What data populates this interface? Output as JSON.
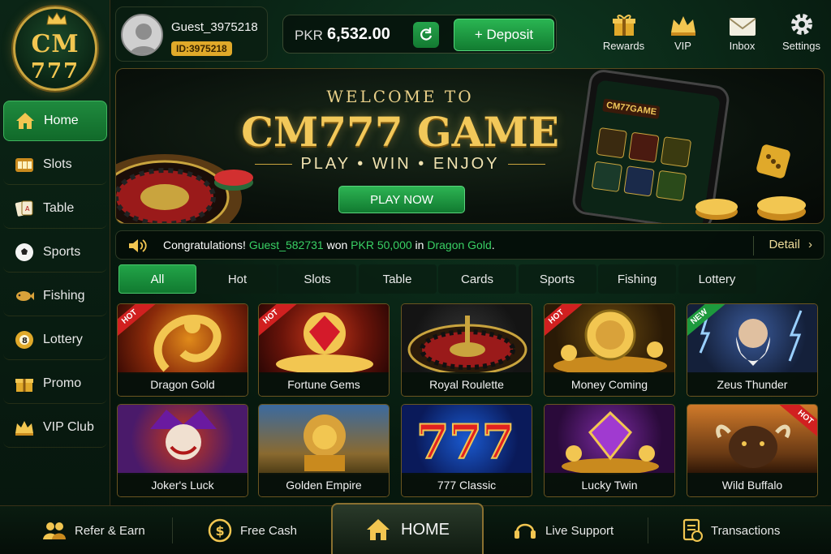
{
  "brand": {
    "logo_line1": "CM",
    "logo_line2": "777"
  },
  "sidebar": {
    "items": [
      {
        "label": "Home",
        "icon": "home-icon",
        "active": true
      },
      {
        "label": "Slots",
        "icon": "slots-icon"
      },
      {
        "label": "Table",
        "icon": "cards-icon"
      },
      {
        "label": "Sports",
        "icon": "soccer-ball-icon"
      },
      {
        "label": "Fishing",
        "icon": "fish-icon"
      },
      {
        "label": "Lottery",
        "icon": "lottery-ball-icon"
      },
      {
        "label": "Promo",
        "icon": "gift-icon"
      },
      {
        "label": "VIP Club",
        "icon": "crown-icon"
      }
    ]
  },
  "user": {
    "name": "Guest_3975218",
    "id": "ID:3975218"
  },
  "wallet": {
    "currency": "PKR",
    "balance": "6,532.00",
    "deposit_label": "+ Deposit"
  },
  "top_icons": [
    {
      "label": "Rewards",
      "icon": "gift-icon"
    },
    {
      "label": "VIP",
      "icon": "crown-icon"
    },
    {
      "label": "Inbox",
      "icon": "envelope-icon"
    },
    {
      "label": "Settings",
      "icon": "gear-icon"
    }
  ],
  "banner": {
    "welcome": "WELCOME TO",
    "title": "CM777 GAME",
    "tagline": "PLAY • WIN • ENJOY",
    "cta": "PLAY NOW",
    "phone_logo": "CM77GAME"
  },
  "ticker": {
    "prefix": "Congratulations! ",
    "user": "Guest_582731",
    "mid": " won ",
    "amount": "PKR 50,000",
    "in": " in ",
    "game": "Dragon Gold",
    "suffix": ".",
    "detail": "Detail"
  },
  "tabs": [
    "All",
    "Hot",
    "Slots",
    "Table",
    "Cards",
    "Sports",
    "Fishing",
    "Lottery"
  ],
  "games": [
    {
      "name": "Dragon Gold",
      "badge": "HOT"
    },
    {
      "name": "Fortune Gems",
      "badge": "HOT"
    },
    {
      "name": "Royal Roulette",
      "badge": ""
    },
    {
      "name": "Money Coming",
      "badge": "HOT"
    },
    {
      "name": "Zeus Thunder",
      "badge": "NEW"
    },
    {
      "name": "Joker's Luck",
      "badge": ""
    },
    {
      "name": "Golden Empire",
      "badge": ""
    },
    {
      "name": "777 Classic",
      "badge": ""
    },
    {
      "name": "Lucky Twin",
      "badge": ""
    },
    {
      "name": "Wild Buffalo",
      "badge": "HOT"
    }
  ],
  "bottom_nav": {
    "refer": "Refer & Earn",
    "free_cash": "Free Cash",
    "home": "HOME",
    "support": "Live Support",
    "transactions": "Transactions"
  },
  "colors": {
    "accent_green": "#1f8a3e",
    "gold": "#f2c651",
    "hot": "#d12020"
  }
}
